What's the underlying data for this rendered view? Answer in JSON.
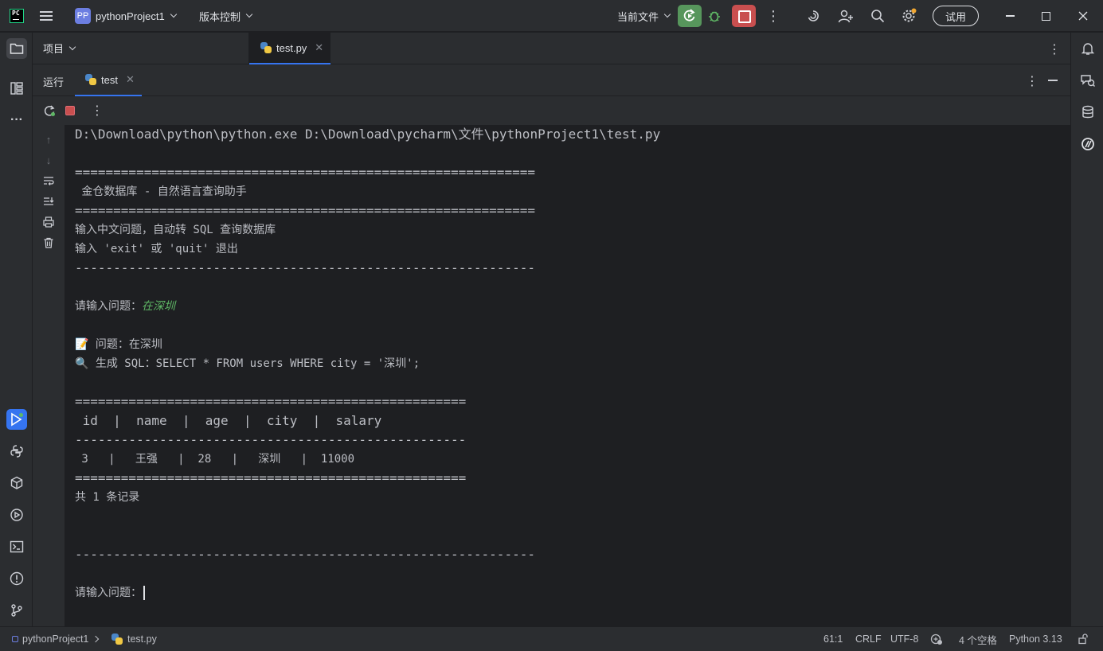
{
  "titlebar": {
    "project_badge": "PP",
    "project_name": "pythonProject1",
    "vcs_label": "版本控制",
    "run_config": "当前文件",
    "trial_label": "试用",
    "icons": [
      "hamburger-menu-icon",
      "run-icon",
      "debug-icon",
      "stop-icon",
      "more-icon",
      "copilot-icon",
      "add-user-icon",
      "search-icon",
      "settings-icon",
      "minimize-icon",
      "maximize-icon",
      "close-icon"
    ]
  },
  "left_strip": [
    "folder-icon",
    "structure-icon",
    "more-icon",
    "run-icon",
    "python-console-icon",
    "python-packages-icon",
    "services-icon",
    "terminal-icon",
    "problems-icon",
    "git-icon"
  ],
  "right_strip": [
    "notifications-icon",
    "ai-chat-icon",
    "database-icon",
    "ai-assistant-icon"
  ],
  "project_panel": {
    "title": "项目"
  },
  "editor": {
    "tab_label": "test.py"
  },
  "run_window": {
    "title": "运行",
    "tab_label": "test"
  },
  "console": {
    "lines": [
      "D:\\Download\\python\\python.exe D:\\Download\\pycharm\\文件\\pythonProject1\\test.py",
      "",
      "============================================================",
      " 金仓数据库 - 自然语言查询助手",
      "============================================================",
      "输入中文问题，自动转 SQL 查询数据库",
      "输入 'exit' 或 'quit' 退出",
      "------------------------------------------------------------",
      "",
      "请输入问题：",
      "",
      "📝 问题：在深圳",
      "🔍 生成 SQL：SELECT * FROM users WHERE city = '深圳';",
      "",
      "===================================================",
      " id  |  name  |  age  |  city  |  salary",
      "---------------------------------------------------",
      " 3   |   王强   |  28   |   深圳   |  11000",
      "===================================================",
      "共 1 条记录",
      "",
      "",
      "------------------------------------------------------------",
      "",
      "请输入问题："
    ],
    "user_input": "在深圳"
  },
  "statusbar": {
    "project": "pythonProject1",
    "file": "test.py",
    "position": "61:1",
    "line_sep": "CRLF",
    "encoding": "UTF-8",
    "indent": "4 个空格",
    "interpreter": "Python 3.13"
  }
}
